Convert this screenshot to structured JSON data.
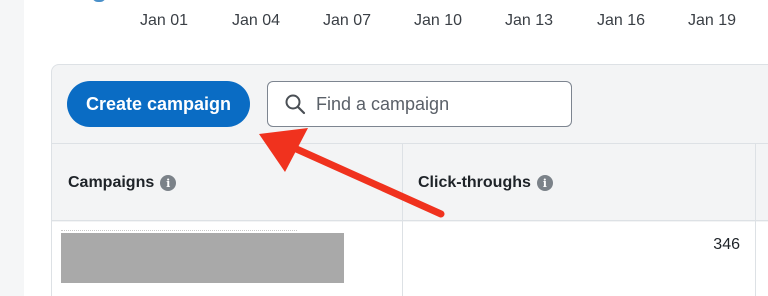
{
  "date_axis": {
    "ticks": [
      "Jan 01",
      "Jan 04",
      "Jan 07",
      "Jan 10",
      "Jan 13",
      "Jan 16",
      "Jan 19"
    ]
  },
  "toolbar": {
    "create_label": "Create campaign",
    "search_placeholder": "Find a campaign"
  },
  "table": {
    "columns": [
      "Campaigns",
      "Click-throughs"
    ],
    "rows": [
      {
        "click_throughs": "346"
      }
    ]
  },
  "colors": {
    "primary_button": "#0a6cc4",
    "annotation_arrow": "#f0321e",
    "redaction": "#a9a9a9"
  }
}
